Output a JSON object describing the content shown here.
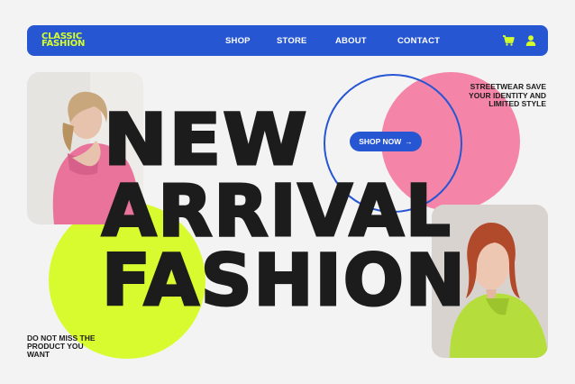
{
  "brand": {
    "logo_line1": "CLASSIC",
    "logo_line2": "FASHION"
  },
  "nav": {
    "links": [
      "SHOP",
      "STORE",
      "ABOUT",
      "CONTACT"
    ],
    "cart_icon": "cart-icon",
    "user_icon": "user-icon"
  },
  "hero": {
    "headline_line1": "NEW",
    "headline_line2": "ARRIVAL",
    "headline_line3": "FASHION",
    "cta_label": "SHOP NOW",
    "cta_arrow": "→",
    "tagline_line1": "STREETWEAR SAVE",
    "tagline_line2": "YOUR IDENTITY AND",
    "tagline_line3": "LIMITED STYLE",
    "note_line1": "DO NOT MISS THE",
    "note_line2": "PRODUCT YOU",
    "note_line3": "WANT"
  },
  "colors": {
    "brand_blue": "#2756d3",
    "lime": "#d8fb2f",
    "pink": "#f485a8",
    "ink": "#1c1c1c",
    "background": "#f3f3f3"
  }
}
